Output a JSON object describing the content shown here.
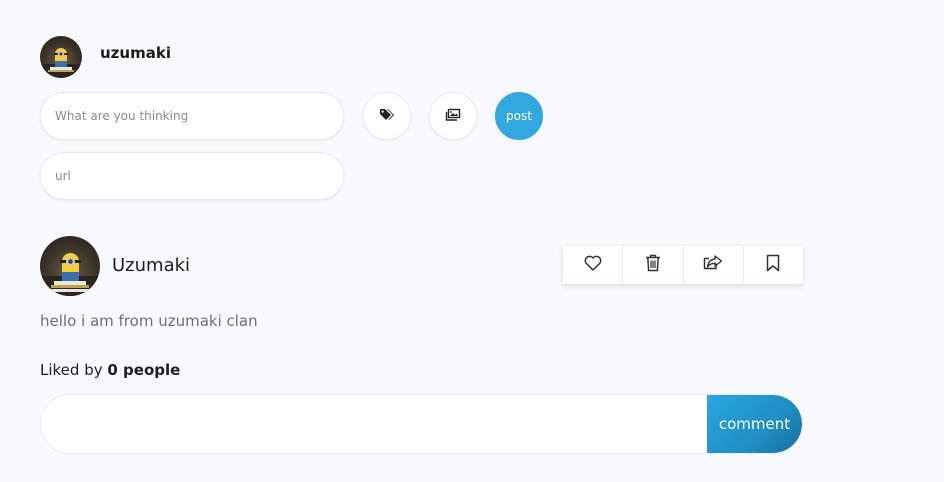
{
  "composer": {
    "username": "uzumaki",
    "thought_placeholder": "What are you thinking",
    "url_placeholder": "url",
    "post_label": "post",
    "icons": [
      "tag-icon",
      "image-icon"
    ]
  },
  "post": {
    "author": "Uzumaki",
    "text": "hello i am from uzumaki clan",
    "liked_prefix": "Liked by",
    "liked_count": "0 people",
    "actions": [
      "heart-icon",
      "trash-icon",
      "share-icon",
      "bookmark-icon"
    ],
    "comment_label": "comment",
    "comment_placeholder": ""
  },
  "colors": {
    "background": "#f7f9fe",
    "accent": "#33a8e0",
    "comment_button": "#1e8fc4"
  }
}
